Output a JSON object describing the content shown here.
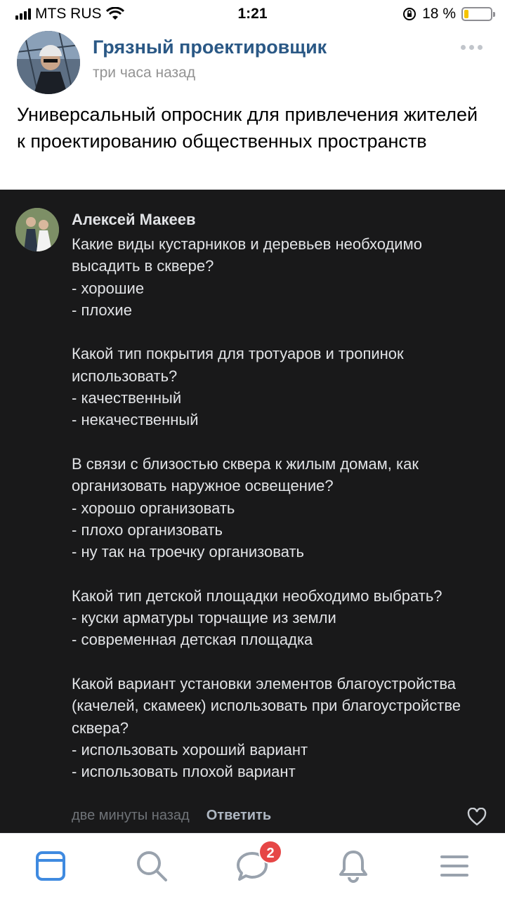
{
  "status_bar": {
    "carrier": "MTS RUS",
    "time": "1:21",
    "battery_percent": "18 %",
    "battery_level": 0.18
  },
  "post": {
    "author": "Грязный проектировщик",
    "time": "три часа назад",
    "text": "Универсальный опросник для привлечения жителей к проектированию общественных пространств"
  },
  "comment": {
    "author": "Алексей Макеев",
    "text": "Какие виды кустарников и деревьев необходимо высадить в сквере?\n- хорошие\n- плохие\n\nКакой тип покрытия для тротуаров и тропинок использовать?\n- качественный\n- некачественный\n\nВ связи с близостью сквера к жилым домам, как организовать наружное освещение?\n- хорошо организовать\n- плохо организовать\n- ну так на троечку организовать\n\nКакой тип детской площадки необходимо выбрать?\n- куски арматуры торчащие из земли\n- современная детская площадка\n\nКакой вариант установки элементов благоустройства (качелей, скамеек) использовать при благоустройстве сквера?\n- использовать хороший вариант\n- использовать плохой вариант",
    "time": "две минуты назад",
    "reply_label": "Ответить"
  },
  "tab_bar": {
    "tabs": [
      "news-icon",
      "search-icon",
      "messages-icon",
      "notifications-icon",
      "menu-icon"
    ],
    "messages_badge": "2"
  },
  "colors": {
    "link": "#2a5885",
    "dark_bg": "#19191a",
    "accent": "#3f8ae0",
    "badge": "#e64646"
  }
}
